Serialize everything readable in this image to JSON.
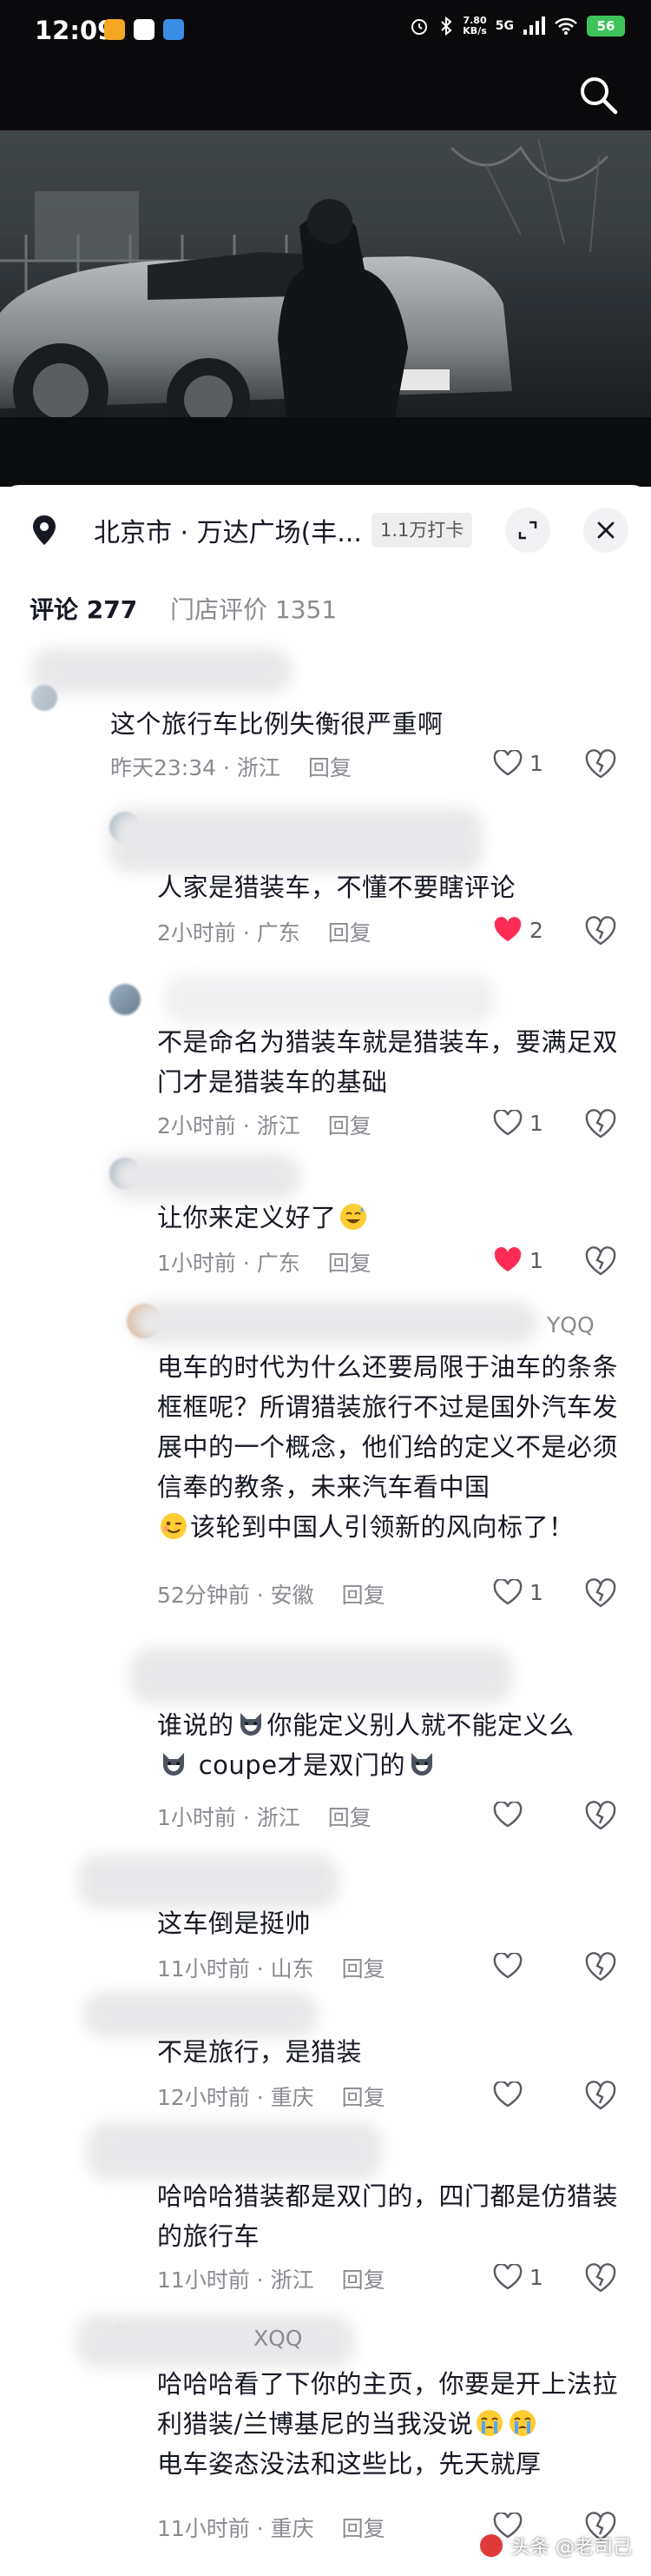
{
  "status_bar": {
    "time": "12:09",
    "net_speed_value": "7.80",
    "net_speed_unit": "KB/s",
    "signal": "5G",
    "battery": "56"
  },
  "location": {
    "name": "北京市 · 万达广场(丰...",
    "checkins": "1.1万打卡"
  },
  "tabs": [
    {
      "label": "评论 277"
    },
    {
      "label": "门店评价 1351"
    }
  ],
  "comments": [
    {
      "username": "",
      "text": "这个旅行车比例失衡很严重啊",
      "time_loc": "昨天23:34 · 浙江",
      "reply": "回复",
      "likes": "1",
      "liked": false
    },
    {
      "username": "",
      "text": "人家是猎装车，不懂不要瞎评论",
      "time_loc": "2小时前 · 广东",
      "reply": "回复",
      "likes": "2",
      "liked": true
    },
    {
      "username": "",
      "text": "不是命名为猎装车就是猎装车，要满足双门才是猎装车的基础",
      "time_loc": "2小时前 · 浙江",
      "reply": "回复",
      "likes": "1",
      "liked": false
    },
    {
      "username": "",
      "text": "让你来定义好了",
      "time_loc": "1小时前 · 广东",
      "reply": "回复",
      "likes": "1",
      "liked": true
    },
    {
      "username": "YQQ",
      "text_parts": [
        "电车的时代为什么还要局限于油车的条条框框呢？所谓猎装旅行不过是国外汽车发展中的一个概念，他们给的定义不是必须信奉的教条，未来汽车看中国",
        "该轮到中国人引领新的风向标了！"
      ],
      "time_loc": "52分钟前 · 安徽",
      "reply": "回复",
      "likes": "1",
      "liked": false
    },
    {
      "username": "",
      "text_parts": [
        "谁说的",
        "你能定义别人就不能定义么",
        "coupe才是双门的"
      ],
      "time_loc": "1小时前 · 浙江",
      "reply": "回复",
      "likes": "",
      "liked": false
    },
    {
      "username": "",
      "text": "这车倒是挺帅",
      "time_loc": "11小时前 · 山东",
      "reply": "回复",
      "likes": "",
      "liked": false
    },
    {
      "username": "",
      "text": "不是旅行，是猎装",
      "time_loc": "12小时前 · 重庆",
      "reply": "回复",
      "likes": "",
      "liked": false
    },
    {
      "username": "",
      "text": "哈哈哈猎装都是双门的，四门都是仿猎装的旅行车",
      "time_loc": "11小时前 · 浙江",
      "reply": "回复",
      "likes": "1",
      "liked": false
    },
    {
      "username": "XQQ",
      "text_parts": [
        "哈哈哈看了下你的主页，你要是开上法拉利猎装/兰博基尼的当我没说",
        "电车姿态没法和这些比，先天就厚"
      ],
      "time_loc": "11小时前 · 重庆",
      "reply": "回复",
      "likes": "",
      "liked": false
    }
  ],
  "watermark": "头条 @老司己",
  "colors": {
    "like_red": "#fe2c55",
    "meta_gray": "#8a8b91",
    "battery_green": "#3ec35a"
  },
  "icons": [
    "search-icon",
    "location-pin-icon",
    "expand-icon",
    "close-icon",
    "heart-icon",
    "broken-heart-icon"
  ]
}
